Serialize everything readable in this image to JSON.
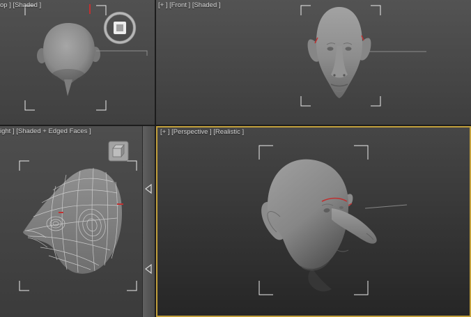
{
  "viewports": {
    "top": {
      "label": "op ] [Shaded ]"
    },
    "front": {
      "label": "[+ ] [Front ] [Shaded ]"
    },
    "right": {
      "label": "ight ] [Shaded + Edged Faces ]"
    },
    "perspective": {
      "label": "[+ ] [Perspective ] [Realistic ]",
      "active": true
    }
  },
  "colors": {
    "active_viewport_border": "#c2a03c",
    "viewport_background_top": "#515151",
    "viewport_background_bottom": "#3b3b3b",
    "perspective_background_top": "#464646",
    "perspective_background_bottom": "#262626",
    "viewport_label_text": "#d4d4d4",
    "selection_bracket": "#ececec",
    "model_surface": "#8f8f8f",
    "wireframe_lines": "#d9d9d9",
    "seam_marker_red": "#c23030",
    "divider": "#1c1c1c"
  },
  "icons": {
    "rotation_ring_gizmo": "circular ring with square handle",
    "cube_button": "3d cube button",
    "layout_tab_arrow": "hollow left-pointing triangle"
  }
}
